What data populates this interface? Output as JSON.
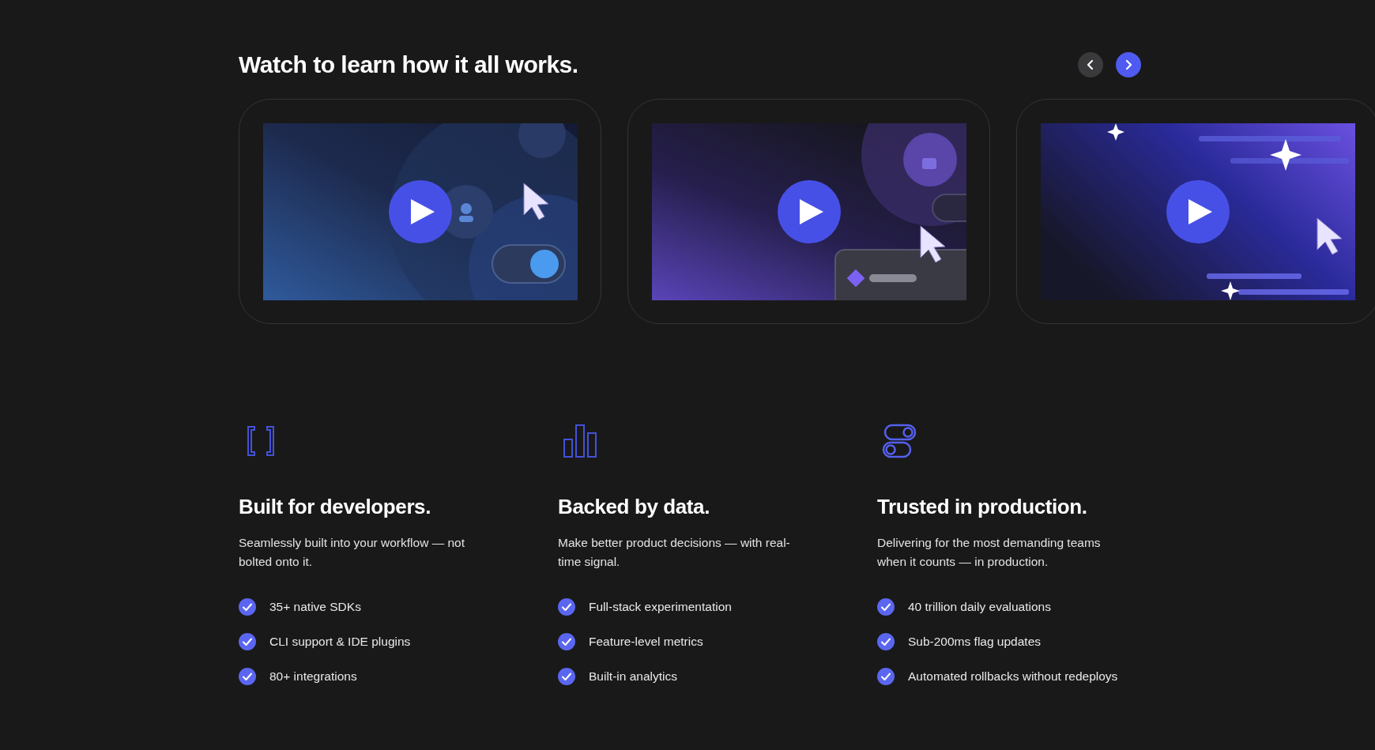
{
  "section": {
    "title": "Watch to learn how it all works."
  },
  "carousel": {
    "prev": {
      "disabled": true
    },
    "next": {
      "disabled": false
    }
  },
  "features": [
    {
      "title": "Built for developers.",
      "description": "Seamlessly built into your workflow — not bolted onto it.",
      "items": [
        "35+ native SDKs",
        "CLI support & IDE plugins",
        "80+ integrations"
      ]
    },
    {
      "title": "Backed by data.",
      "description": "Make better product decisions — with real-time signal.",
      "items": [
        "Full-stack experimentation",
        "Feature-level metrics",
        "Built-in analytics"
      ]
    },
    {
      "title": "Trusted in production.",
      "description": "Delivering for the most demanding teams when it counts — in production.",
      "items": [
        "40 trillion daily evaluations",
        "Sub-200ms flag updates",
        "Automated rollbacks without redeploys"
      ]
    }
  ]
}
